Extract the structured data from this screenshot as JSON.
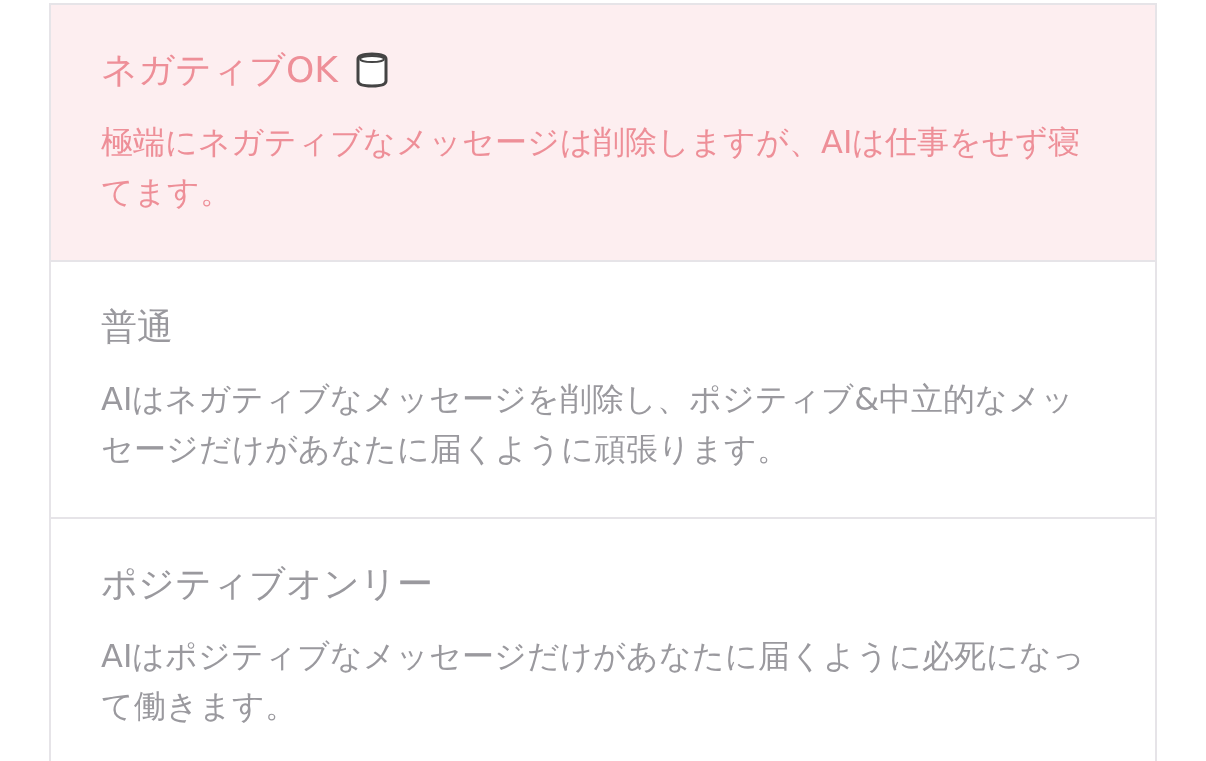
{
  "options": [
    {
      "title": "ネガティブOK",
      "description": "極端にネガティブなメッセージは削除しますが、AIは仕事をせず寝てます。",
      "selected": true,
      "icon": true
    },
    {
      "title": "普通",
      "description": "AIはネガティブなメッセージを削除し、ポジティブ&中立的なメッセージだけがあなたに届くように頑張ります。",
      "selected": false,
      "icon": false
    },
    {
      "title": "ポジティブオンリー",
      "description": "AIはポジティブなメッセージだけがあなたに届くように必死になって働きます。",
      "selected": false,
      "icon": false
    }
  ]
}
